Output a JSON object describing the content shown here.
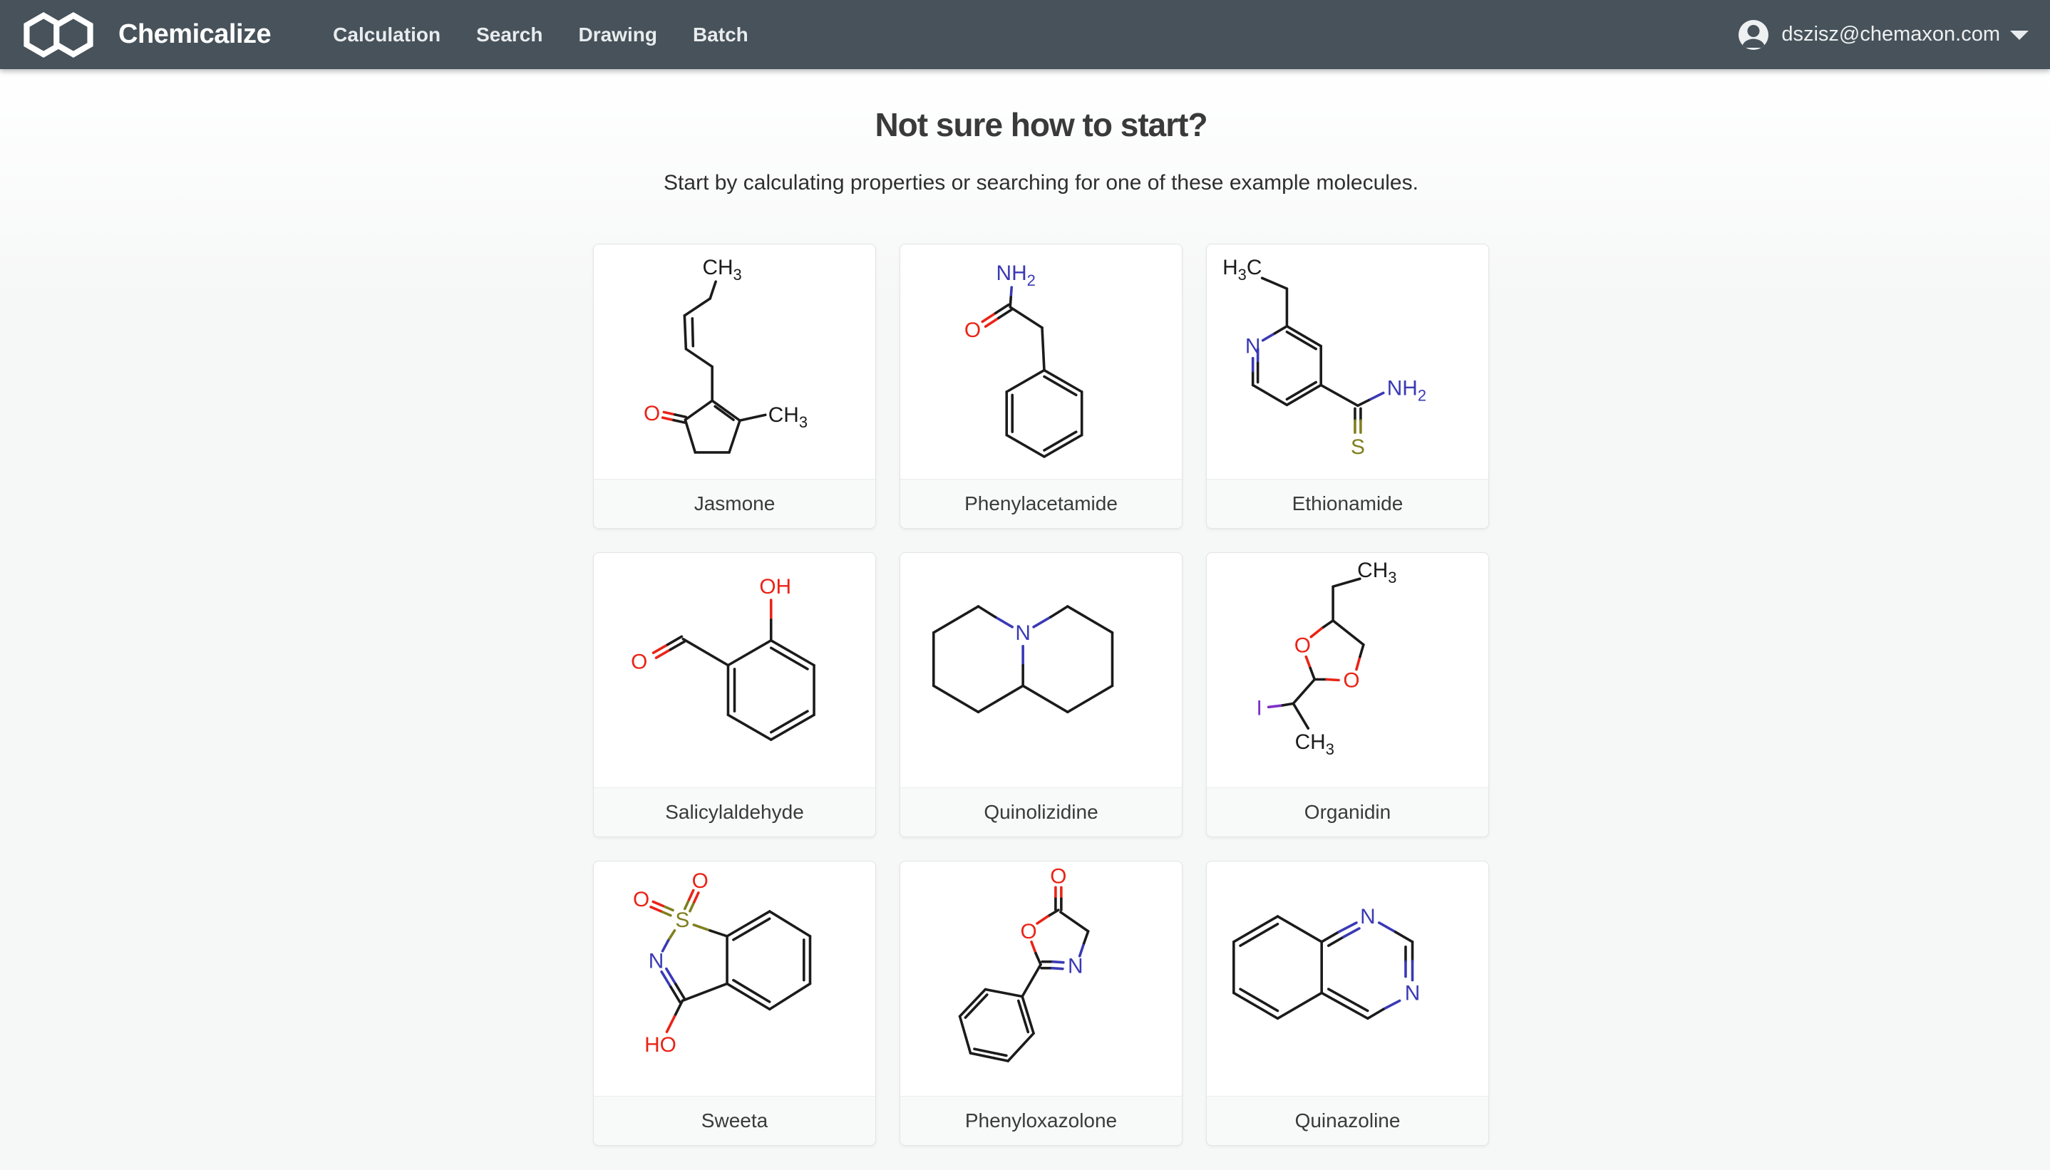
{
  "navbar": {
    "brand": "Chemicalize",
    "items": [
      {
        "label": "Calculation"
      },
      {
        "label": "Search"
      },
      {
        "label": "Drawing"
      },
      {
        "label": "Batch"
      }
    ],
    "user_email": "dszisz@chemaxon.com"
  },
  "hero": {
    "title": "Not sure how to start?",
    "subtitle": "Start by calculating properties or searching for one of these example molecules."
  },
  "colors": {
    "navbar_bg": "#47525a",
    "oxygen_red": "#ea2316",
    "nitrogen_blue": "#3939b5",
    "sulfur_olive": "#7f7f1f",
    "iodine_purple": "#7d2fc9"
  },
  "cards": [
    {
      "name": "Jasmone",
      "atoms": [
        {
          "main": "CH",
          "sub": "3"
        },
        {
          "main": "CH",
          "sub": "3"
        },
        {
          "main": "O"
        }
      ]
    },
    {
      "name": "Phenylacetamide",
      "atoms": [
        {
          "main": "NH",
          "sub": "2"
        },
        {
          "main": "O"
        }
      ]
    },
    {
      "name": "Ethionamide",
      "atoms": [
        {
          "main": "H",
          "sub": "3",
          "tail": "C"
        },
        {
          "main": "N"
        },
        {
          "main": "NH",
          "sub": "2"
        },
        {
          "main": "S"
        }
      ]
    },
    {
      "name": "Salicylaldehyde",
      "atoms": [
        {
          "main": "OH"
        },
        {
          "main": "O"
        }
      ]
    },
    {
      "name": "Quinolizidine",
      "atoms": [
        {
          "main": "N"
        }
      ]
    },
    {
      "name": "Organidin",
      "atoms": [
        {
          "main": "CH",
          "sub": "3"
        },
        {
          "main": "O"
        },
        {
          "main": "O"
        },
        {
          "main": "I"
        },
        {
          "main": "CH",
          "sub": "3"
        }
      ]
    },
    {
      "name": "Sweeta",
      "atoms": [
        {
          "main": "O"
        },
        {
          "main": "O"
        },
        {
          "main": "S"
        },
        {
          "main": "N"
        },
        {
          "main": "HO"
        }
      ]
    },
    {
      "name": "Phenyloxazolone",
      "atoms": [
        {
          "main": "O"
        },
        {
          "main": "O"
        },
        {
          "main": "N"
        }
      ]
    },
    {
      "name": "Quinazoline",
      "atoms": [
        {
          "main": "N"
        },
        {
          "main": "N"
        }
      ]
    }
  ]
}
